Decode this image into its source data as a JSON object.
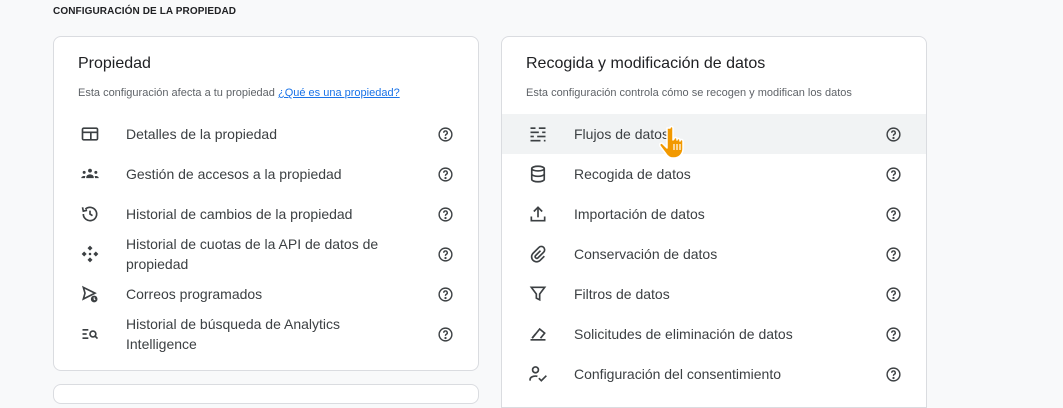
{
  "section_title": "CONFIGURACIÓN DE LA PROPIEDAD",
  "left_card": {
    "title": "Propiedad",
    "subtitle": "Esta configuración afecta a tu propiedad",
    "link": "¿Qué es una propiedad?",
    "items": [
      {
        "label": "Detalles de la propiedad",
        "icon": "property-details-icon"
      },
      {
        "label": "Gestión de accesos a la propiedad",
        "icon": "people-icon"
      },
      {
        "label": "Historial de cambios de la propiedad",
        "icon": "history-icon"
      },
      {
        "label": "Historial de cuotas de la API de datos de propiedad",
        "icon": "api-quota-icon"
      },
      {
        "label": "Correos programados",
        "icon": "scheduled-email-icon"
      },
      {
        "label": "Historial de búsqueda de Analytics Intelligence",
        "icon": "search-history-icon"
      }
    ]
  },
  "right_card": {
    "title": "Recogida y modificación de datos",
    "subtitle": "Esta configuración controla cómo se recogen y modifican los datos",
    "items": [
      {
        "label": "Flujos de datos",
        "icon": "data-streams-icon"
      },
      {
        "label": "Recogida de datos",
        "icon": "database-icon"
      },
      {
        "label": "Importación de datos",
        "icon": "upload-icon"
      },
      {
        "label": "Conservación de datos",
        "icon": "retention-icon"
      },
      {
        "label": "Filtros de datos",
        "icon": "filter-icon"
      },
      {
        "label": "Solicitudes de eliminación de datos",
        "icon": "eraser-icon"
      },
      {
        "label": "Configuración del consentimiento",
        "icon": "consent-icon"
      }
    ]
  },
  "colors": {
    "link": "#1a73e8",
    "hover_row": "#f1f3f4",
    "cursor": "#f29900"
  }
}
